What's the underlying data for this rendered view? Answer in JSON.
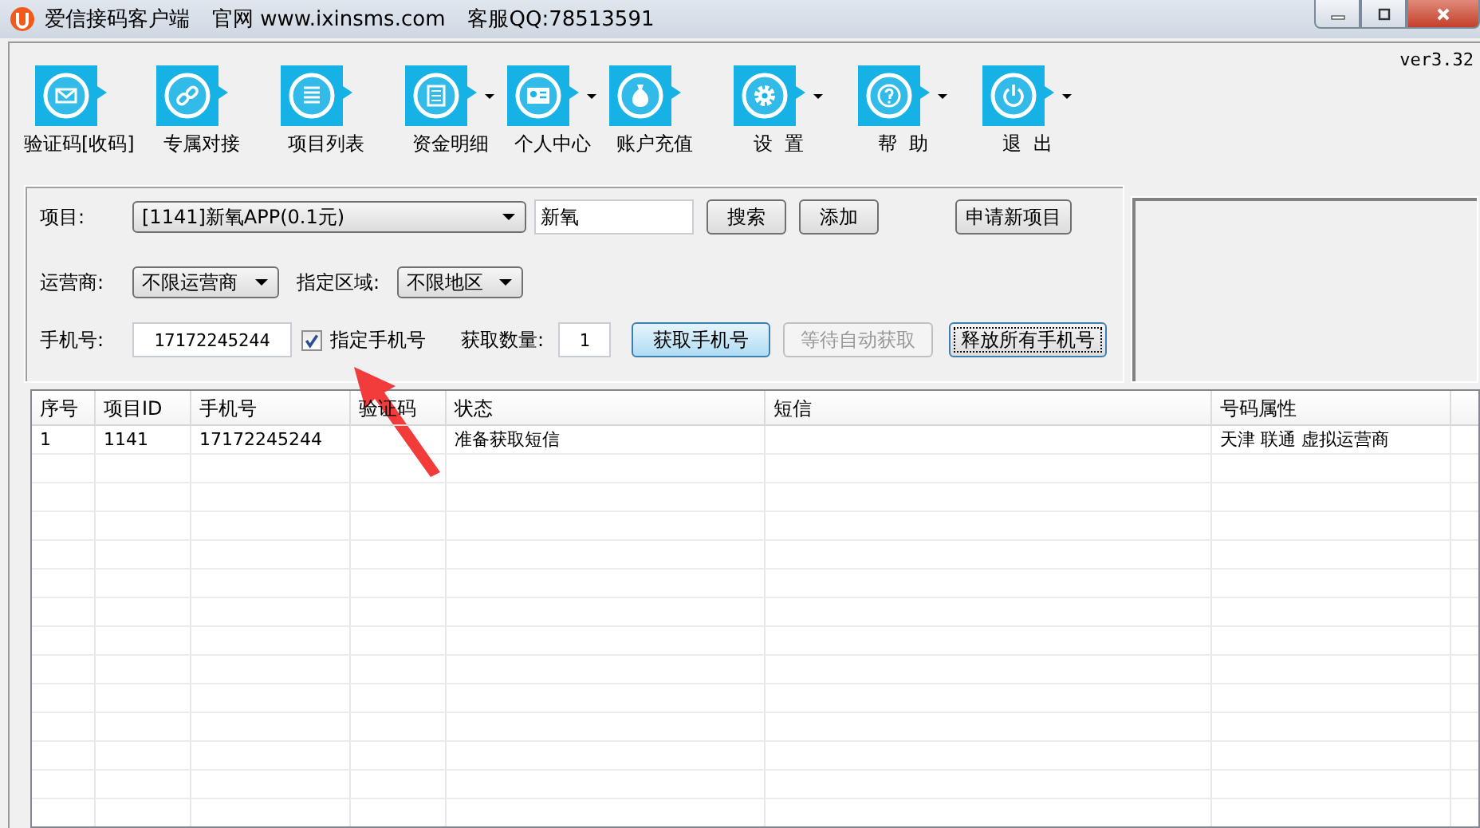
{
  "window": {
    "title": "爱信接码客户端",
    "website": "官网 www.ixinsms.com",
    "service": "客服QQ:78513591"
  },
  "version": "ver3.32",
  "toolbar": [
    {
      "label": "验证码[收码]",
      "kind": "envelope",
      "dropdown": false
    },
    {
      "label": "专属对接",
      "kind": "link",
      "dropdown": false
    },
    {
      "label": "项目列表",
      "kind": "list",
      "dropdown": false
    },
    {
      "label": "资金明细",
      "kind": "document",
      "dropdown": true
    },
    {
      "label": "个人中心",
      "kind": "card",
      "dropdown": true
    },
    {
      "label": "账户充值",
      "kind": "bag",
      "dropdown": false
    },
    {
      "label": "设  置",
      "kind": "gear",
      "dropdown": true
    },
    {
      "label": "帮  助",
      "kind": "help",
      "dropdown": true
    },
    {
      "label": "退  出",
      "kind": "power",
      "dropdown": true
    }
  ],
  "form": {
    "project": {
      "label": "项目:",
      "value": "[1141]新氧APP(0.1元)"
    },
    "search_field": {
      "value": "新氧"
    },
    "carrier": {
      "label": "运营商:",
      "value": "不限运营商"
    },
    "region": {
      "label": "指定区域:",
      "value": "不限地区"
    },
    "phone": {
      "label": "手机号:",
      "value": "17172245244"
    },
    "specify_phone": {
      "label": "指定手机号",
      "checked": true
    },
    "quantity": {
      "label": "获取数量:",
      "value": "1"
    },
    "buttons": [
      {
        "label": "搜索",
        "disabled": false,
        "primary": false,
        "focused": false
      },
      {
        "label": "添加",
        "disabled": false,
        "primary": false,
        "focused": false
      },
      {
        "label": "申请新项目",
        "disabled": false,
        "primary": false,
        "focused": false
      },
      {
        "label": "获取手机号",
        "disabled": false,
        "primary": true,
        "focused": false
      },
      {
        "label": "等待自动获取",
        "disabled": true,
        "primary": false,
        "focused": false
      },
      {
        "label": "释放所有手机号",
        "disabled": false,
        "primary": false,
        "focused": true
      }
    ]
  },
  "table": {
    "columns": [
      "序号",
      "项目ID",
      "手机号",
      "验证码",
      "状态",
      "短信",
      "号码属性"
    ],
    "rows": [
      [
        "1",
        "1141",
        "17172245244",
        "",
        "准备获取短信",
        "",
        "天津 联通 虚拟运营商"
      ]
    ]
  }
}
